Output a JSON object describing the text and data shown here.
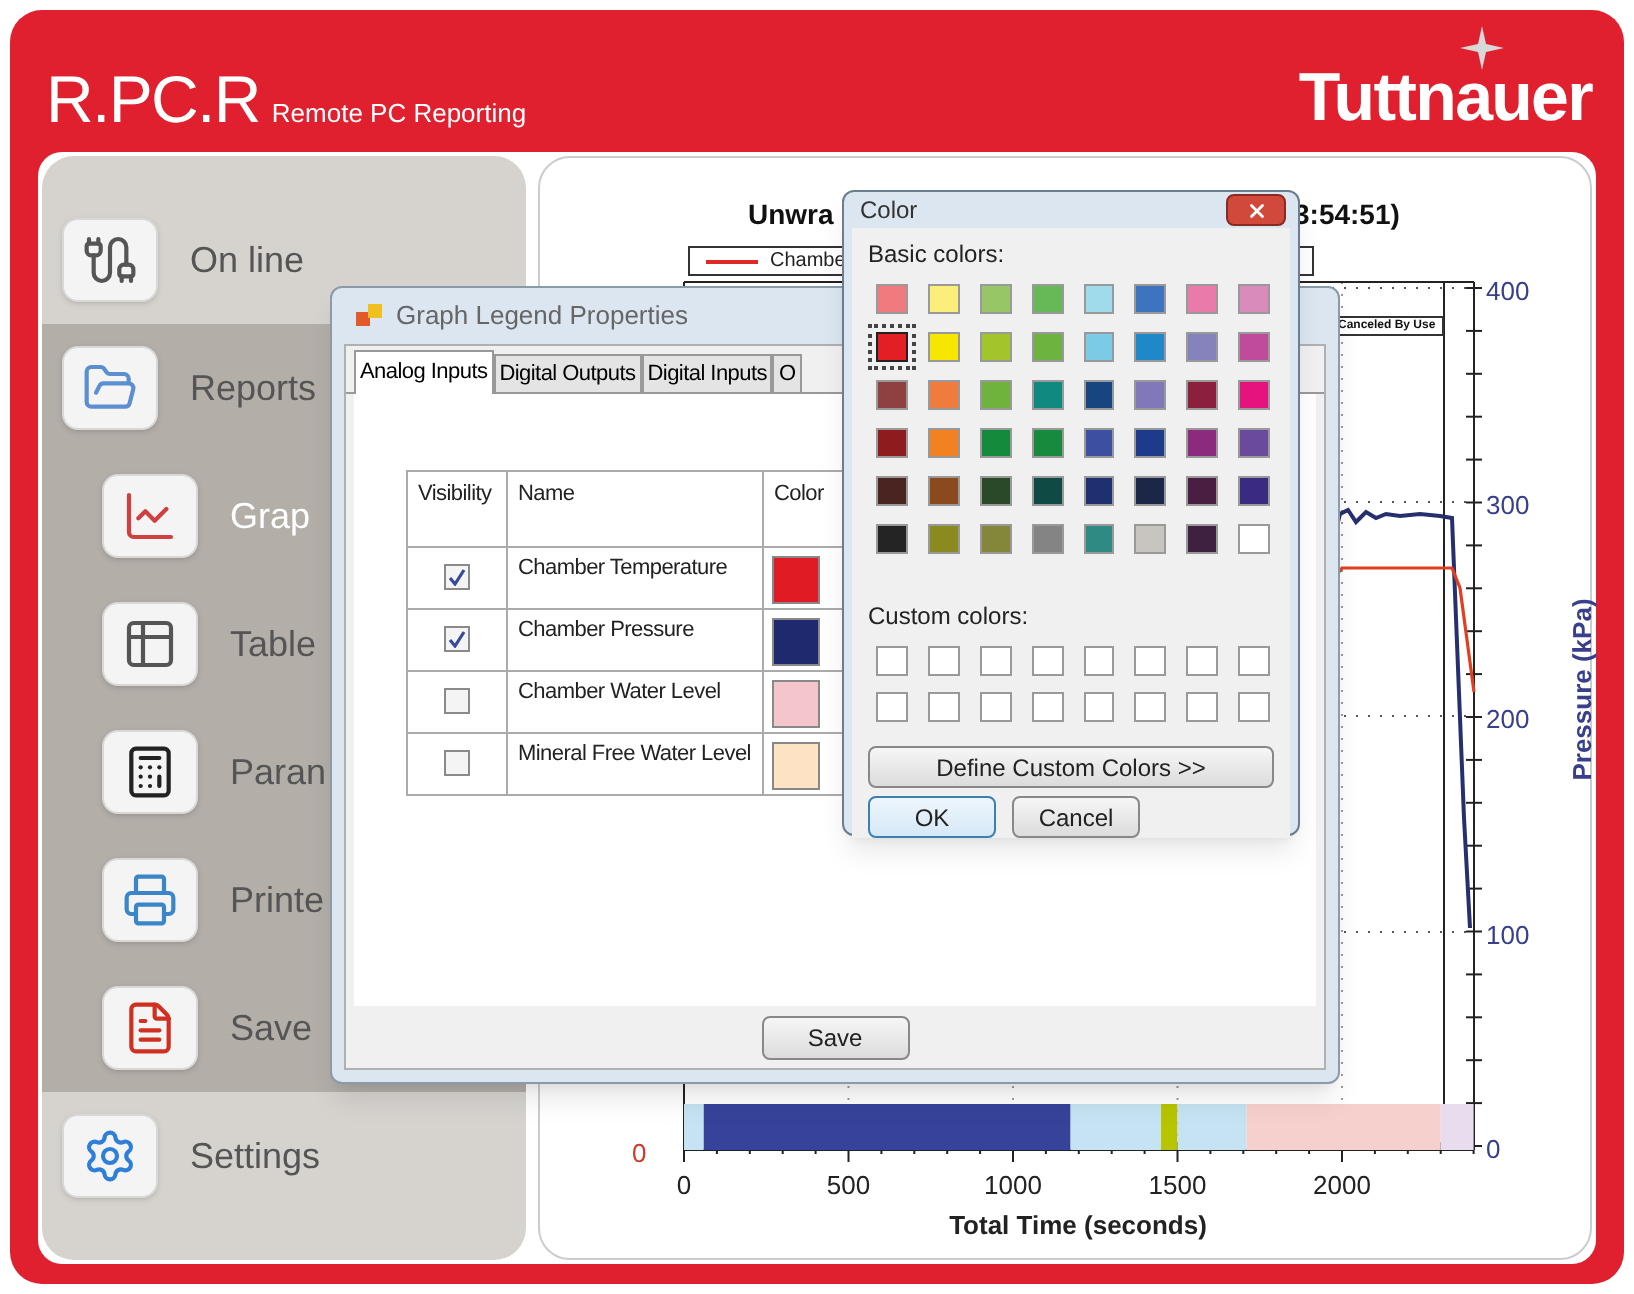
{
  "header": {
    "title": "R.PC.R",
    "subtitle": "Remote PC Reporting",
    "brand": "Tuttnauer"
  },
  "sidebar": {
    "items": [
      {
        "label": "On line",
        "selected": false
      },
      {
        "label": "Reports",
        "selected": false,
        "expanded": true,
        "children": [
          {
            "label": "Grap",
            "selected": true
          },
          {
            "label": "Table",
            "selected": false
          },
          {
            "label": "Paran",
            "selected": false
          },
          {
            "label": "Printe",
            "selected": false
          },
          {
            "label": "Save",
            "selected": false
          }
        ]
      },
      {
        "label": "Settings",
        "selected": false
      }
    ]
  },
  "chart": {
    "title_left": "Unwra",
    "title_right": "3:54:51)",
    "legend": [
      {
        "label": "Chambe",
        "color": "#e02828"
      }
    ],
    "note": "Canceled By Use",
    "left_ticks": [
      "0"
    ],
    "right_ticks": [
      "400",
      "300",
      "200",
      "100",
      "0"
    ],
    "xticks": [
      "0",
      "500",
      "1000",
      "1500",
      "2000"
    ],
    "xlabel": "Total Time (seconds)",
    "ylabel_right": "Pressure (kPa)",
    "phases": [
      {
        "color": "#c5e3f2"
      },
      {
        "color": "#36439a"
      },
      {
        "color": "#c5e3f2"
      },
      {
        "color": "#b8c400"
      },
      {
        "color": "#c5e3f2"
      },
      {
        "color": "#f6d0cc"
      },
      {
        "color": "#e8dcee"
      }
    ]
  },
  "legend_dialog": {
    "title": "Graph Legend Properties",
    "tabs": [
      {
        "label": "Analog Inputs",
        "selected": true
      },
      {
        "label": "Digital Outputs",
        "selected": false
      },
      {
        "label": "Digital Inputs",
        "selected": false
      },
      {
        "label": "O",
        "selected": false
      }
    ],
    "columns": [
      "Visibility",
      "Name",
      "Color"
    ],
    "rows": [
      {
        "name": "Chamber Temperature",
        "checked": true,
        "color": "#e01b24"
      },
      {
        "name": "Chamber Pressure",
        "checked": true,
        "color": "#1f2a6e"
      },
      {
        "name": "Chamber Water Level",
        "checked": false,
        "color": "#f4c6cc"
      },
      {
        "name": "Mineral Free Water Level",
        "checked": false,
        "color": "#fde2c4"
      }
    ],
    "save": "Save"
  },
  "color_dialog": {
    "title": "Color",
    "basic_label": "Basic colors:",
    "basic": [
      {
        "color": "#ef7b7f",
        "selected": false
      },
      {
        "color": "#fbee7b",
        "selected": false
      },
      {
        "color": "#96c666",
        "selected": false
      },
      {
        "color": "#67b957",
        "selected": false
      },
      {
        "color": "#9fdbea",
        "selected": false
      },
      {
        "color": "#3d74c0",
        "selected": false
      },
      {
        "color": "#e97aa9",
        "selected": false
      },
      {
        "color": "#d98bbb",
        "selected": false
      },
      {
        "color": "#e31e24",
        "selected": true
      },
      {
        "color": "#f7e600",
        "selected": false
      },
      {
        "color": "#a3c52c",
        "selected": false
      },
      {
        "color": "#6db33f",
        "selected": false
      },
      {
        "color": "#7ccbe6",
        "selected": false
      },
      {
        "color": "#1e88c8",
        "selected": false
      },
      {
        "color": "#8582bc",
        "selected": false
      },
      {
        "color": "#c04b9c",
        "selected": false
      },
      {
        "color": "#8f4040",
        "selected": false
      },
      {
        "color": "#ef7b3c",
        "selected": false
      },
      {
        "color": "#6fb33c",
        "selected": false
      },
      {
        "color": "#108a80",
        "selected": false
      },
      {
        "color": "#17457f",
        "selected": false
      },
      {
        "color": "#8078b8",
        "selected": false
      },
      {
        "color": "#8c1f3e",
        "selected": false
      },
      {
        "color": "#e6127e",
        "selected": false
      },
      {
        "color": "#8e1c1e",
        "selected": false
      },
      {
        "color": "#f28121",
        "selected": false
      },
      {
        "color": "#148a3c",
        "selected": false
      },
      {
        "color": "#188a3e",
        "selected": false
      },
      {
        "color": "#3d4fa0",
        "selected": false
      },
      {
        "color": "#1e3a8a",
        "selected": false
      },
      {
        "color": "#8c2a7e",
        "selected": false
      },
      {
        "color": "#6a4a9c",
        "selected": false
      },
      {
        "color": "#4a2420",
        "selected": false
      },
      {
        "color": "#8a4a1e",
        "selected": false
      },
      {
        "color": "#284a28",
        "selected": false
      },
      {
        "color": "#104a44",
        "selected": false
      },
      {
        "color": "#1e3070",
        "selected": false
      },
      {
        "color": "#1c2748",
        "selected": false
      },
      {
        "color": "#4a1e40",
        "selected": false
      },
      {
        "color": "#3a2a80",
        "selected": false
      },
      {
        "color": "#242424",
        "selected": false
      },
      {
        "color": "#8a8a20",
        "selected": false
      },
      {
        "color": "#84863a",
        "selected": false
      },
      {
        "color": "#848484",
        "selected": false
      },
      {
        "color": "#2f8a84",
        "selected": false
      },
      {
        "color": "#c8c4c0",
        "selected": false
      },
      {
        "color": "#3e2040",
        "selected": false
      },
      {
        "color": "#ffffff",
        "selected": false
      }
    ],
    "custom_label": "Custom colors:",
    "custom": [
      {
        "color": "#ffffff"
      },
      {
        "color": "#ffffff"
      },
      {
        "color": "#ffffff"
      },
      {
        "color": "#ffffff"
      },
      {
        "color": "#ffffff"
      },
      {
        "color": "#ffffff"
      },
      {
        "color": "#ffffff"
      },
      {
        "color": "#ffffff"
      },
      {
        "color": "#ffffff"
      },
      {
        "color": "#ffffff"
      },
      {
        "color": "#ffffff"
      },
      {
        "color": "#ffffff"
      },
      {
        "color": "#ffffff"
      },
      {
        "color": "#ffffff"
      },
      {
        "color": "#ffffff"
      },
      {
        "color": "#ffffff"
      }
    ],
    "define_button": "Define Custom Colors >>",
    "ok_button": "OK",
    "cancel_button": "Cancel"
  }
}
